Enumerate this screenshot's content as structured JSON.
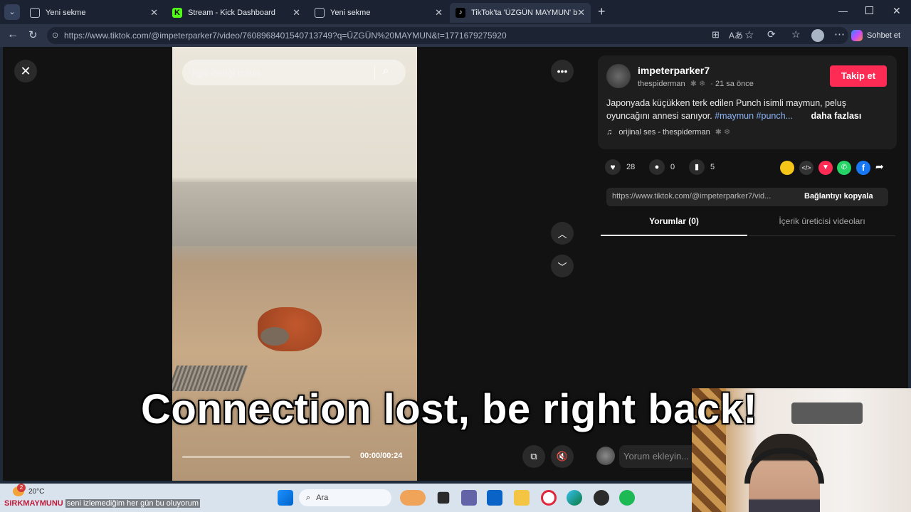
{
  "browser": {
    "tabs": [
      {
        "label": "Yeni sekme",
        "active": false
      },
      {
        "label": "Stream - Kick Dashboard",
        "active": false
      },
      {
        "label": "Yeni sekme",
        "active": false
      },
      {
        "label": "TikTok'ta 'ÜZGÜN MAYMUN' bulal",
        "active": true
      }
    ],
    "url": "https://www.tiktok.com/@impeterparker7/video/7608968401540713749?q=ÜZGÜN%20MAYMUN&t=1771679275920",
    "chat_label": "Sohbet et"
  },
  "player": {
    "search_placeholder": "İlgili içeriği bulun",
    "time": "00:00/00:24",
    "progress": 0.0
  },
  "post": {
    "username": "impeterparker7",
    "nickname": "thespiderman",
    "time_ago": "· 21 sa önce",
    "follow_label": "Takip et",
    "caption": "Japonyada küçükken terk edilen Punch isimli maymun, peluş oyuncağını annesi sanıyor.",
    "hashtags": "#maymun #punch...",
    "more_label": "daha fazlası",
    "sound": "orijinal ses - thespiderman",
    "likes": "28",
    "comments": "0",
    "saves": "5",
    "share_url": "https://www.tiktok.com/@impeterparker7/vid...",
    "copy_link_label": "Bağlantıyı kopyala",
    "tabs": [
      "Yorumlar (0)",
      "İçerik üreticisi videoları"
    ],
    "comment_placeholder": "Yorum ekleyin..."
  },
  "overlay": {
    "message": "Connection lost, be right back!"
  },
  "taskbar": {
    "weather": "20°C",
    "weather_badge": "2",
    "ticker_name": "SIRKMAYMUNU",
    "ticker_text": "seni izlemediğim her gün bu oluyorum",
    "search_label": "Ara"
  },
  "colors": {
    "follow": "#fe2c55",
    "hashtag": "#8ab4f8",
    "page_bg": "#121212"
  }
}
